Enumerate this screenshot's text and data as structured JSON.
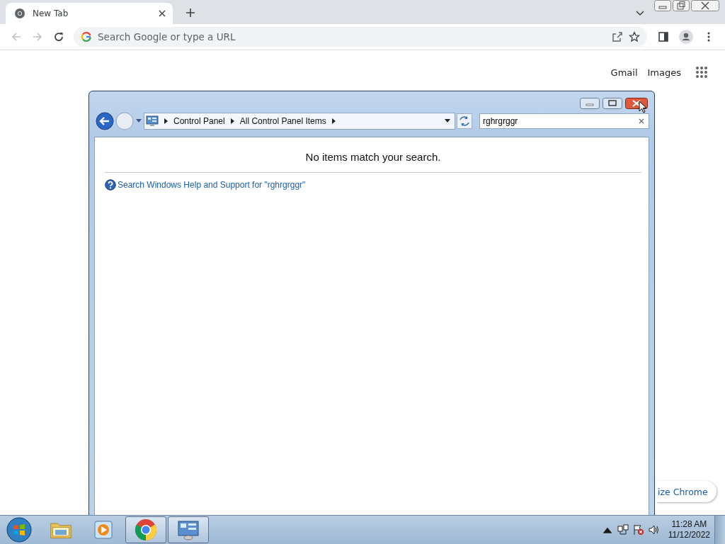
{
  "browser": {
    "tab": {
      "title": "New Tab"
    },
    "address_bar": {
      "placeholder": "Search Google or type a URL"
    },
    "page": {
      "links": [
        "Gmail",
        "Images"
      ],
      "customize_button": "ize Chrome"
    }
  },
  "explorer": {
    "breadcrumb": [
      "Control Panel",
      "All Control Panel Items"
    ],
    "search": {
      "value": "rghrgrggr"
    },
    "message": "No items match your search.",
    "help_link": "Search Windows Help and Support for \"rghrgrggr\""
  },
  "taskbar": {
    "items": [
      {
        "kind": "folder",
        "open": false
      },
      {
        "kind": "media",
        "open": false
      },
      {
        "kind": "chrome",
        "open": true
      },
      {
        "kind": "control-panel",
        "open": true
      }
    ],
    "clock": {
      "time": "11:28 AM",
      "date": "11/12/2022"
    }
  }
}
